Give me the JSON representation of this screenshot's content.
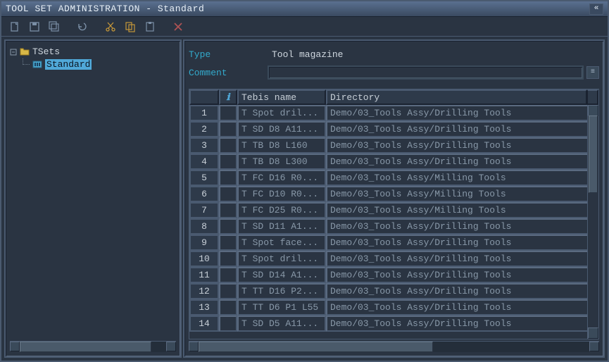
{
  "window": {
    "title": "TOOL SET ADMINISTRATION - Standard"
  },
  "toolbar": {
    "icons": [
      "new",
      "save",
      "save-all",
      "undo",
      "cut",
      "copy",
      "paste",
      "delete"
    ]
  },
  "tree": {
    "root": {
      "label": "TSets"
    },
    "child": {
      "label": "Standard",
      "selected": true
    }
  },
  "form": {
    "type_label": "Type",
    "type_value": "Tool magazine",
    "comment_label": "Comment",
    "comment_value": ""
  },
  "grid": {
    "columns": {
      "info": "ℹ",
      "name": "Tebis name",
      "dir": "Directory"
    },
    "rows": [
      {
        "n": 1,
        "name": "T Spot dril...",
        "dir": "Demo/03_Tools Assy/Drilling Tools"
      },
      {
        "n": 2,
        "name": "T SD D8 A11...",
        "dir": "Demo/03_Tools Assy/Drilling Tools"
      },
      {
        "n": 3,
        "name": "T TB D8 L160",
        "dir": "Demo/03_Tools Assy/Drilling Tools"
      },
      {
        "n": 4,
        "name": "T TB D8 L300",
        "dir": "Demo/03_Tools Assy/Drilling Tools"
      },
      {
        "n": 5,
        "name": "T FC D16 R0...",
        "dir": "Demo/03_Tools Assy/Milling Tools"
      },
      {
        "n": 6,
        "name": "T FC D10 R0...",
        "dir": "Demo/03_Tools Assy/Milling Tools"
      },
      {
        "n": 7,
        "name": "T FC D25 R0...",
        "dir": "Demo/03_Tools Assy/Milling Tools"
      },
      {
        "n": 8,
        "name": "T SD D11 A1...",
        "dir": "Demo/03_Tools Assy/Drilling Tools"
      },
      {
        "n": 9,
        "name": "T Spot face...",
        "dir": "Demo/03_Tools Assy/Drilling Tools"
      },
      {
        "n": 10,
        "name": "T Spot dril...",
        "dir": "Demo/03_Tools Assy/Drilling Tools"
      },
      {
        "n": 11,
        "name": "T SD D14 A1...",
        "dir": "Demo/03_Tools Assy/Drilling Tools"
      },
      {
        "n": 12,
        "name": "T TT D16 P2...",
        "dir": "Demo/03_Tools Assy/Drilling Tools"
      },
      {
        "n": 13,
        "name": "T TT D6 P1 L55",
        "dir": "Demo/03_Tools Assy/Drilling Tools"
      },
      {
        "n": 14,
        "name": "T SD D5 A11...",
        "dir": "Demo/03_Tools Assy/Drilling Tools"
      }
    ]
  },
  "colors": {
    "accent": "#33aacc",
    "highlight": "#50a8d8",
    "cut_accent": "#e0a838"
  }
}
